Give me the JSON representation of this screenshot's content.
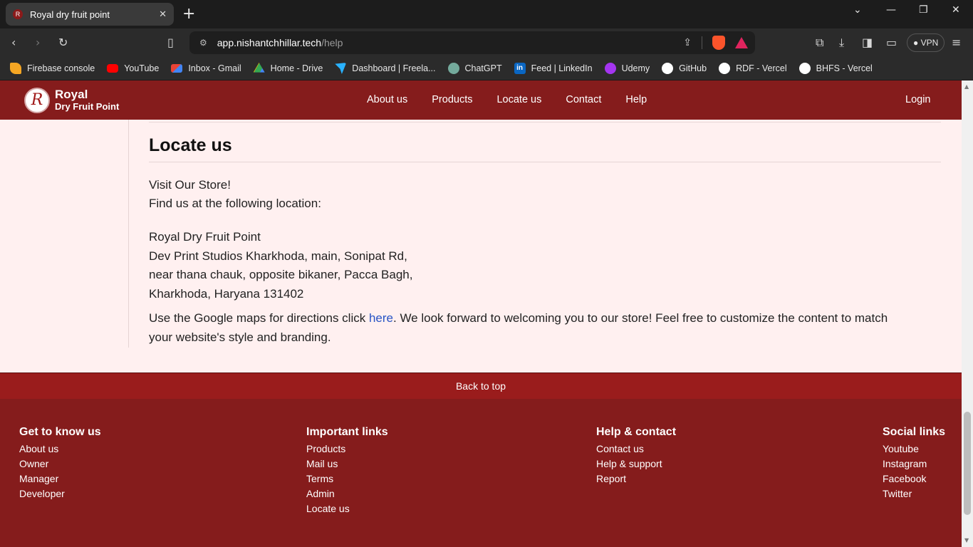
{
  "browser": {
    "tab_title": "Royal dry fruit point",
    "new_tab": "+",
    "url_host": "app.nishantchhillar.tech",
    "url_path": "/help",
    "vpn_label": "VPN",
    "bookmarks": [
      {
        "label": "Firebase console",
        "icon": "firebase-icon",
        "color": "#f5a623"
      },
      {
        "label": "YouTube",
        "icon": "youtube-icon",
        "color": "#ff0000"
      },
      {
        "label": "Inbox - Gmail",
        "icon": "gmail-icon",
        "color": "#ea4335"
      },
      {
        "label": "Home - Drive",
        "icon": "drive-icon",
        "color": "#34a853"
      },
      {
        "label": "Dashboard | Freela...",
        "icon": "freelancer-icon",
        "color": "#29b2fe"
      },
      {
        "label": "ChatGPT",
        "icon": "chatgpt-icon",
        "color": "#74aa9c"
      },
      {
        "label": "Feed | LinkedIn",
        "icon": "linkedin-icon",
        "color": "#0a66c2"
      },
      {
        "label": "Udemy",
        "icon": "udemy-icon",
        "color": "#a435f0"
      },
      {
        "label": "GitHub",
        "icon": "github-icon",
        "color": "#ffffff"
      },
      {
        "label": "RDF - Vercel",
        "icon": "vercel-icon",
        "color": "#ffffff"
      },
      {
        "label": "BHFS - Vercel",
        "icon": "vercel-icon",
        "color": "#ffffff"
      }
    ]
  },
  "site": {
    "brand_line1": "Royal",
    "brand_line2": "Dry Fruit Point",
    "logo_letter": "R",
    "nav": [
      "About us",
      "Products",
      "Locate us",
      "Contact",
      "Help"
    ],
    "login": "Login",
    "accent": "#851c1c"
  },
  "locate": {
    "title": "Locate us",
    "line1": "Visit Our Store!",
    "line2": "Find us at the following location:",
    "address": [
      "Royal Dry Fruit Point",
      "Dev Print Studios Kharkhoda, main, Sonipat Rd,",
      "near thana chauk, opposite bikaner, Pacca Bagh,",
      "Kharkhoda, Haryana 131402"
    ],
    "directions_before": "Use the Google maps for directions click ",
    "directions_link": "here",
    "directions_after": ". We look forward to welcoming you to our store! Feel free to customize the content to match",
    "directions_line2": "your website's style and branding."
  },
  "footer": {
    "back_to_top": "Back to top",
    "columns": [
      {
        "title": "Get to know us",
        "links": [
          "About us",
          "Owner",
          "Manager",
          "Developer"
        ]
      },
      {
        "title": "Important links",
        "links": [
          "Products",
          "Mail us",
          "Terms",
          "Admin",
          "Locate us"
        ]
      },
      {
        "title": "Help & contact",
        "links": [
          "Contact us",
          "Help & support",
          "Report"
        ]
      },
      {
        "title": "Social links",
        "links": [
          "Youtube",
          "Instagram",
          "Facebook",
          "Twitter"
        ]
      }
    ]
  }
}
